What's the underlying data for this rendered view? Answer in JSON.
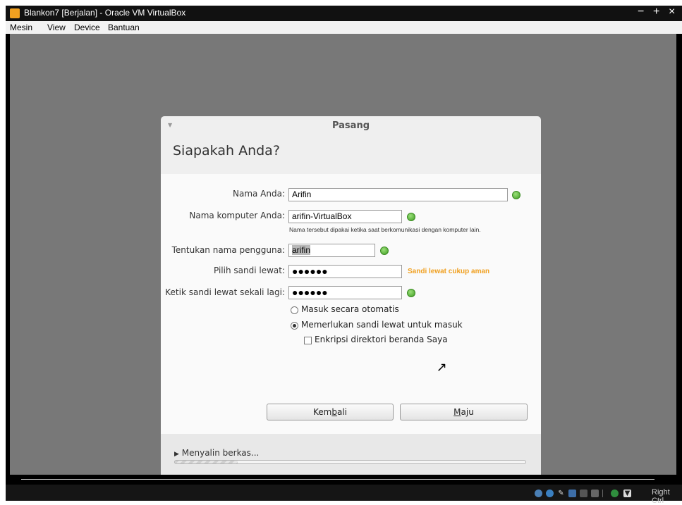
{
  "window": {
    "title": "Blankon7 [Berjalan] - Oracle VM VirtualBox",
    "minimize": "−",
    "maximize": "+",
    "close": "×"
  },
  "menubar": {
    "items": [
      "Mesin",
      "View",
      "Device",
      "Bantuan"
    ]
  },
  "dialog": {
    "title": "Pasang",
    "heading": "Siapakah Anda?",
    "form": {
      "name_label": "Nama Anda:",
      "name_value": "Arifin",
      "computer_label": "Nama komputer Anda:",
      "computer_value": "arifin-VirtualBox",
      "computer_hint": "Nama tersebut dipakai ketika saat berkomunikasi dengan komputer lain.",
      "username_label": "Tentukan nama pengguna:",
      "username_value": "arifin",
      "password_label": "Pilih sandi lewat:",
      "password_value": "●●●●●●",
      "password_strength": "Sandi lewat cukup aman",
      "confirm_label": "Ketik sandi lewat sekali lagi:",
      "confirm_value": "●●●●●●"
    },
    "options": {
      "auto_login": "Masuk secara otomatis",
      "require_password": "Memerlukan sandi lewat untuk masuk",
      "encrypt_home": "Enkripsi direktori beranda Saya",
      "selected": "require_password",
      "encrypt_checked": false
    },
    "buttons": {
      "back_pre": "Kem",
      "back_u": "b",
      "back_post": "ali",
      "forward_pre": "",
      "forward_u": "M",
      "forward_post": "aju"
    },
    "progress": {
      "label": "Menyalin berkas...",
      "expander_icon": "triangle-right-icon",
      "fraction": 0.18
    }
  },
  "statusbar": {
    "right_ctrl": "Right Ctrl",
    "icons": [
      "hdd-icon",
      "cd-icon",
      "usb-icon",
      "network-icon",
      "shared-folder-icon",
      "display-icon",
      "capture-icon",
      "arrow-down-icon"
    ]
  },
  "colors": {
    "strength_text": "#f0a020",
    "ok_indicator": "#4caf2c",
    "guest_bg": "#787878"
  }
}
